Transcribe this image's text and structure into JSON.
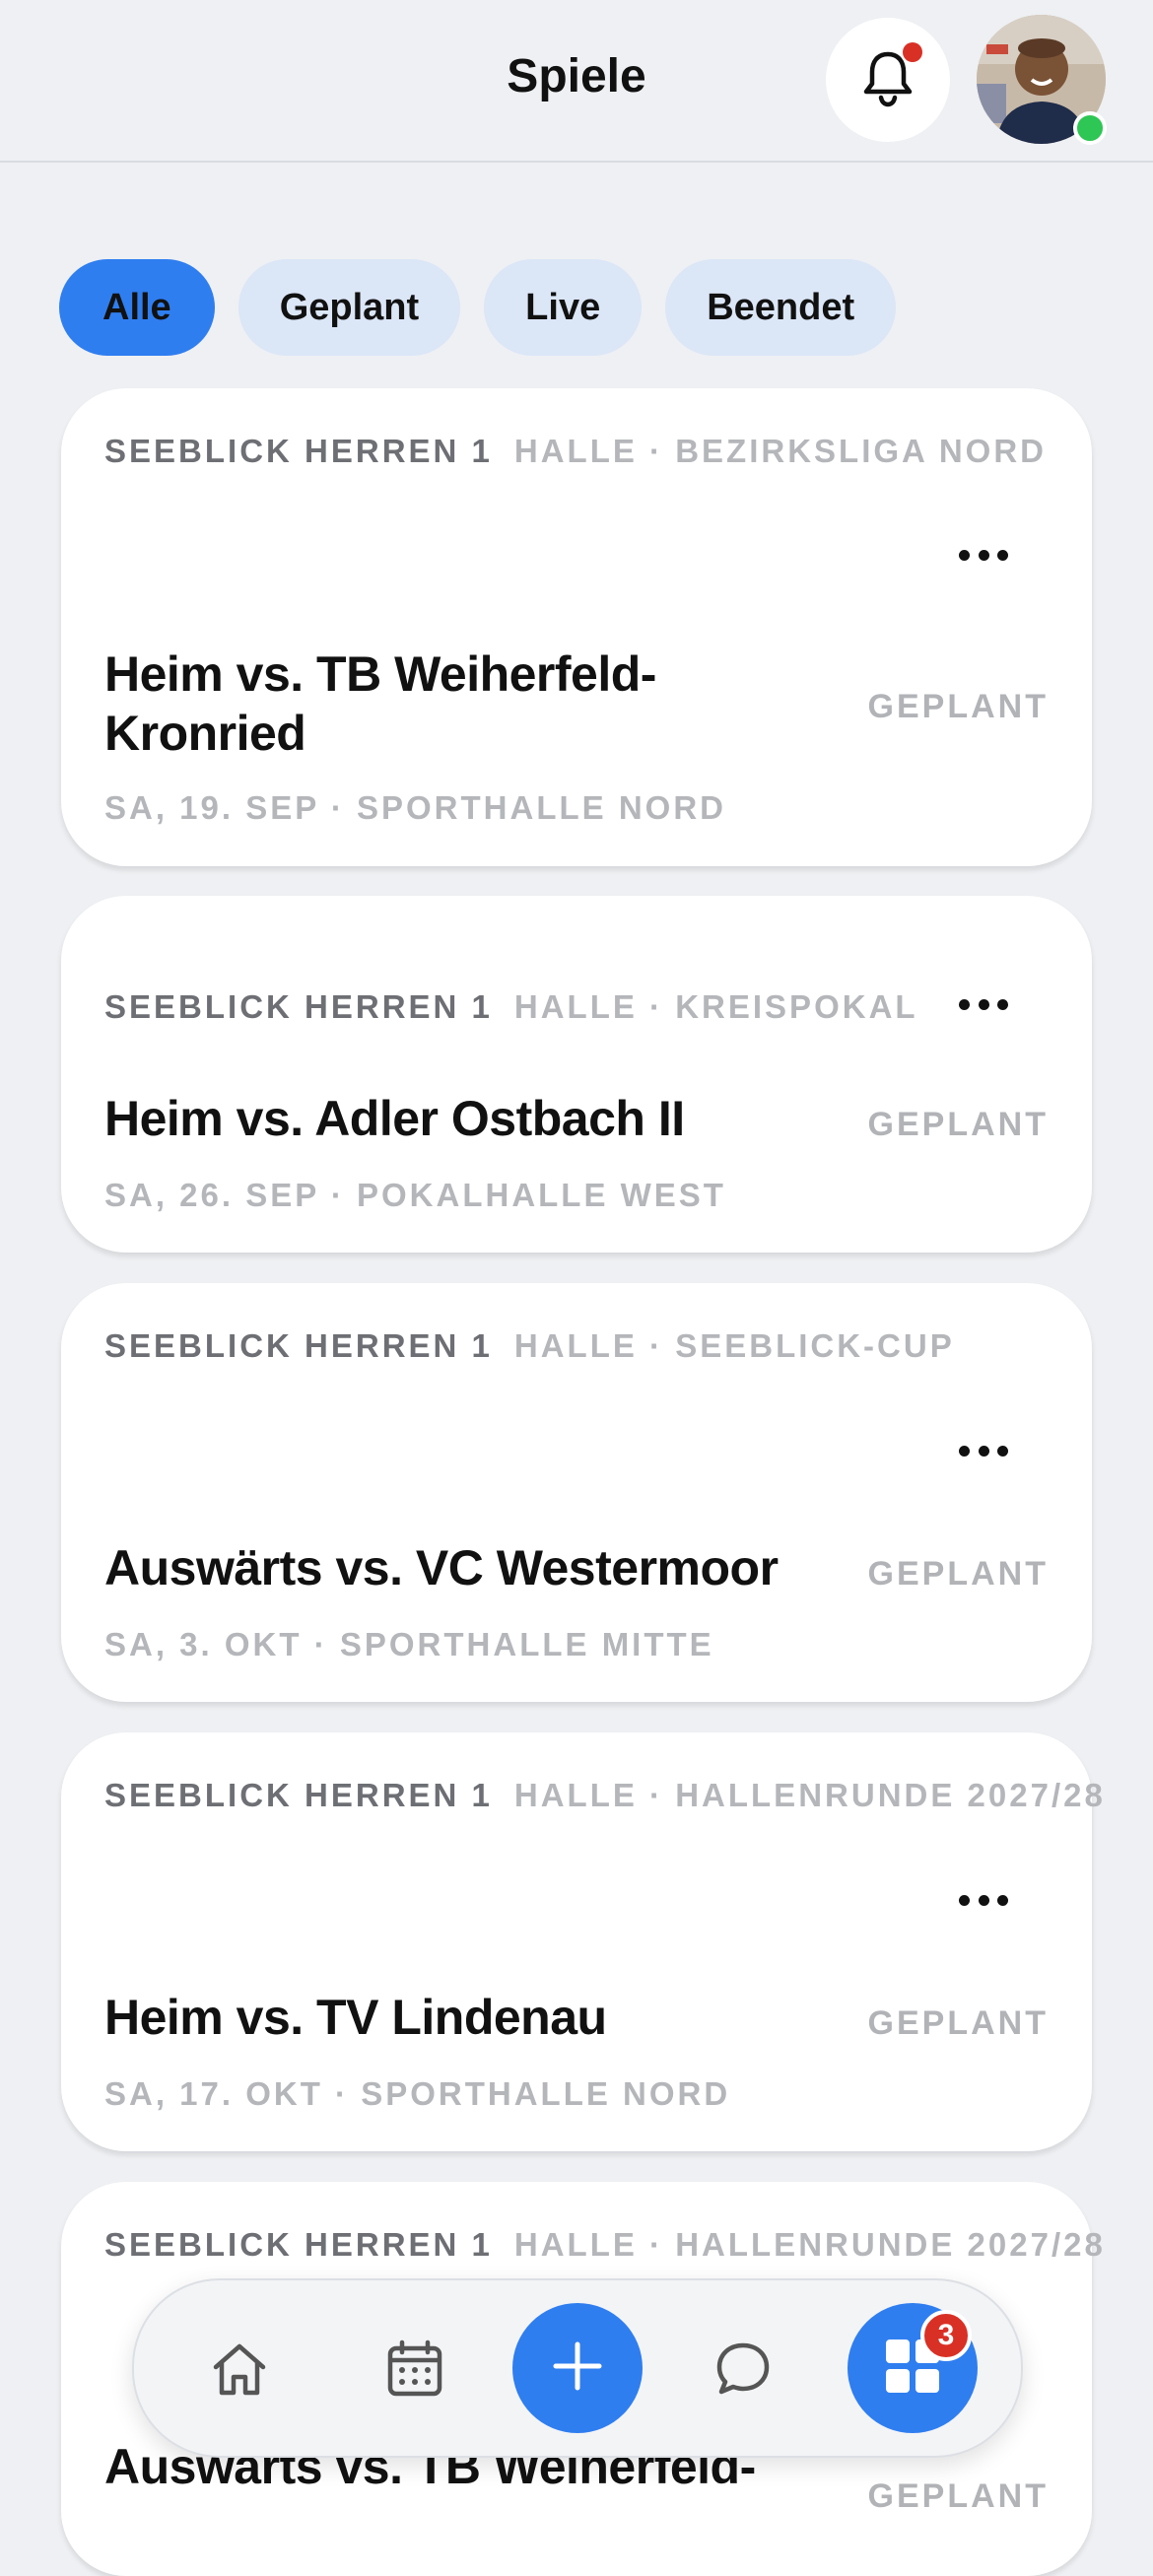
{
  "header": {
    "title": "Spiele"
  },
  "filters": [
    "Alle",
    "Geplant",
    "Live",
    "Beendet"
  ],
  "games": [
    {
      "team": "SEEBLICK HERREN 1",
      "league": "HALLE · BEZIRKSLIGA NORD",
      "line1": "Heim vs. TB Weiherfeld-",
      "line2": "Kronried",
      "status": "GEPLANT",
      "date": "SA, 19. SEP · SPORTHALLE NORD"
    },
    {
      "team": "SEEBLICK HERREN 1",
      "league": "HALLE · KREISPOKAL",
      "line1": "Heim vs. Adler Ostbach II",
      "line2": "",
      "status": "GEPLANT",
      "date": "SA, 26. SEP · POKALHALLE WEST"
    },
    {
      "team": "SEEBLICK HERREN 1",
      "league": "HALLE · SEEBLICK-CUP",
      "line1": "Auswärts vs. VC Westermoor",
      "line2": "",
      "status": "GEPLANT",
      "date": "SA, 3. OKT · SPORTHALLE MITTE"
    },
    {
      "team": "SEEBLICK HERREN 1",
      "league": "HALLE · HALLENRUNDE 2027/28",
      "line1": "Heim vs. TV Lindenau",
      "line2": "",
      "status": "GEPLANT",
      "date": "SA, 17. OKT · SPORTHALLE NORD"
    },
    {
      "team": "SEEBLICK HERREN 1",
      "league": "HALLE · HALLENRUNDE 2027/28",
      "line1": "Auswärts vs. TB Weiherfeld-",
      "line2": "",
      "status": "GEPLANT",
      "date": ""
    }
  ],
  "tabbar": {
    "badge_count": "3"
  },
  "colors": {
    "accent": "#2f7ef0",
    "chip_bg": "#dbe6f7",
    "badge": "#d93025",
    "online": "#2ec654"
  },
  "icons": [
    "bell-icon",
    "home-icon",
    "calendar-icon",
    "plus-icon",
    "chat-bubble-icon",
    "grid-icon",
    "more-icon"
  ]
}
